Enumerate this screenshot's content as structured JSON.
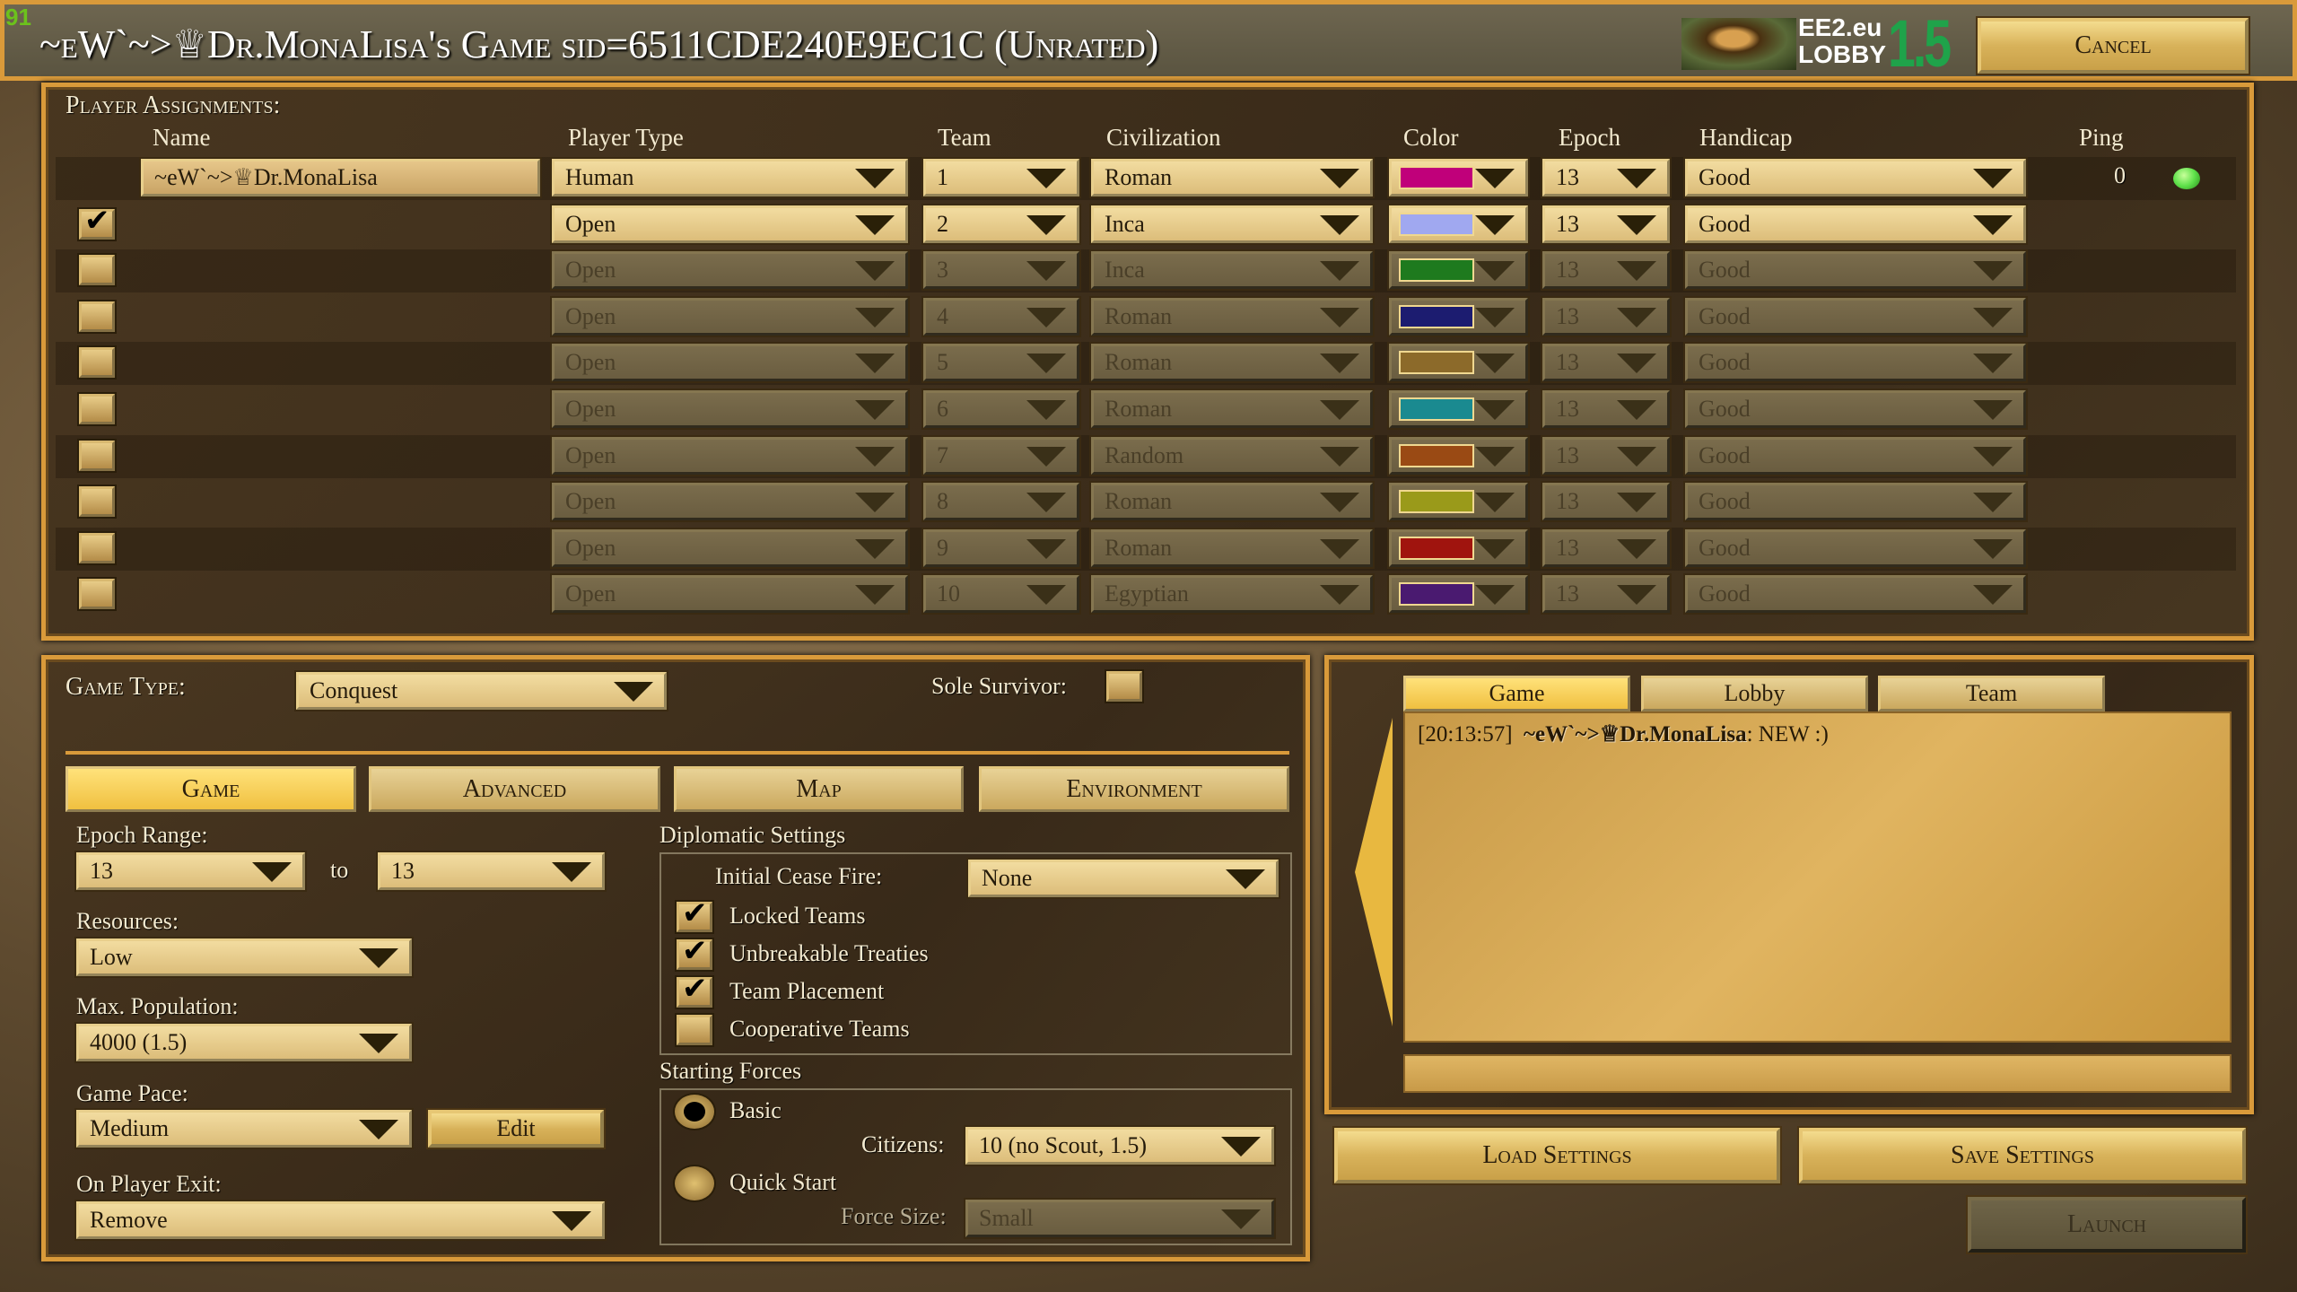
{
  "fps": "91",
  "title": "~eW`~>♕Dr.MonaLisa's Game sid=6511CDE240E9EC1C (Unrated)",
  "logo": {
    "line1": "EE2.eu",
    "line2": "LOBBY",
    "version": "1.5"
  },
  "cancel_label": "Cancel",
  "players": {
    "section_label": "Player Assignments:",
    "headers": {
      "name": "Name",
      "type": "Player Type",
      "team": "Team",
      "civ": "Civilization",
      "color": "Color",
      "epoch": "Epoch",
      "handicap": "Handicap",
      "ping": "Ping"
    },
    "rows": [
      {
        "name": "~eW`~>♕Dr.MonaLisa",
        "type": "Human",
        "team": "1",
        "civ": "Roman",
        "color": "#c0007a",
        "epoch": "13",
        "handicap": "Good",
        "ping": "0",
        "active": true,
        "checked": null
      },
      {
        "name": "",
        "type": "Open",
        "team": "2",
        "civ": "Inca",
        "color": "#a0a8f0",
        "epoch": "13",
        "handicap": "Good",
        "ping": "",
        "active": true,
        "checked": true
      },
      {
        "name": "",
        "type": "Open",
        "team": "3",
        "civ": "Inca",
        "color": "#1e7a1e",
        "epoch": "13",
        "handicap": "Good",
        "ping": "",
        "active": false,
        "checked": false
      },
      {
        "name": "",
        "type": "Open",
        "team": "4",
        "civ": "Roman",
        "color": "#1c1c70",
        "epoch": "13",
        "handicap": "Good",
        "ping": "",
        "active": false,
        "checked": false
      },
      {
        "name": "",
        "type": "Open",
        "team": "5",
        "civ": "Roman",
        "color": "#8c6a2a",
        "epoch": "13",
        "handicap": "Good",
        "ping": "",
        "active": false,
        "checked": false
      },
      {
        "name": "",
        "type": "Open",
        "team": "6",
        "civ": "Roman",
        "color": "#1a8a90",
        "epoch": "13",
        "handicap": "Good",
        "ping": "",
        "active": false,
        "checked": false
      },
      {
        "name": "",
        "type": "Open",
        "team": "7",
        "civ": "Random",
        "color": "#9a4a14",
        "epoch": "13",
        "handicap": "Good",
        "ping": "",
        "active": false,
        "checked": false
      },
      {
        "name": "",
        "type": "Open",
        "team": "8",
        "civ": "Roman",
        "color": "#9a9a1a",
        "epoch": "13",
        "handicap": "Good",
        "ping": "",
        "active": false,
        "checked": false
      },
      {
        "name": "",
        "type": "Open",
        "team": "9",
        "civ": "Roman",
        "color": "#a0140e",
        "epoch": "13",
        "handicap": "Good",
        "ping": "",
        "active": false,
        "checked": false
      },
      {
        "name": "",
        "type": "Open",
        "team": "10",
        "civ": "Egyptian",
        "color": "#4a1a70",
        "epoch": "13",
        "handicap": "Good",
        "ping": "",
        "active": false,
        "checked": false
      }
    ]
  },
  "settings": {
    "game_type_label": "Game Type:",
    "game_type": "Conquest",
    "sole_survivor_label": "Sole Survivor:",
    "sole_survivor": false,
    "tabs": [
      "Game",
      "Advanced",
      "Map",
      "Environment"
    ],
    "epoch_range_label": "Epoch Range:",
    "epoch_from": "13",
    "to": "to",
    "epoch_to": "13",
    "resources_label": "Resources:",
    "resources": "Low",
    "max_pop_label": "Max. Population:",
    "max_pop": "4000 (1.5)",
    "pace_label": "Game Pace:",
    "pace": "Medium",
    "edit_label": "Edit",
    "exit_label": "On Player Exit:",
    "exit": "Remove",
    "diplo_label": "Diplomatic Settings",
    "cease_label": "Initial Cease Fire:",
    "cease": "None",
    "diplo_options": [
      {
        "label": "Locked Teams",
        "checked": true
      },
      {
        "label": "Unbreakable Treaties",
        "checked": true
      },
      {
        "label": "Team Placement",
        "checked": true
      },
      {
        "label": "Cooperative Teams",
        "checked": false
      }
    ],
    "forces_label": "Starting Forces",
    "basic_label": "Basic",
    "citizens_label": "Citizens:",
    "citizens": "10 (no Scout, 1.5)",
    "quick_label": "Quick Start",
    "force_size_label": "Force Size:",
    "force_size": "Small",
    "selected_force": "Basic"
  },
  "chat": {
    "tabs": [
      "Game",
      "Lobby",
      "Team"
    ],
    "active_tab": "Game",
    "messages": [
      {
        "time": "[20:13:57]",
        "user": "~eW`~>♕Dr.MonaLisa",
        "text": ": NEW :)"
      }
    ],
    "input": ""
  },
  "load_label": "Load Settings",
  "save_label": "Save Settings",
  "launch_label": "Launch",
  "colors": {
    "accent": "#d99a3a",
    "ping_ok": "#5ee04a",
    "logo_green": "#1fa34a"
  }
}
